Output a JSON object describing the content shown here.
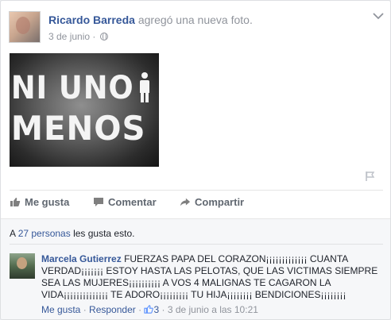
{
  "post": {
    "author": "Ricardo Barreda",
    "action": "agregó una nueva foto.",
    "date": "3 de junio",
    "dot": "·",
    "photo_text": {
      "line1": "NI UNO",
      "line2": "MENOS"
    }
  },
  "actions": {
    "like": "Me gusta",
    "comment": "Comentar",
    "share": "Compartir"
  },
  "likes_summary": {
    "prefix": "A ",
    "people": "27 personas",
    "suffix": " les gusta esto."
  },
  "comment": {
    "author": "Marcela Gutierrez",
    "text": "FUERZAS PAPA DEL CORAZON¡¡¡¡¡¡¡¡¡¡¡¡¡ CUANTA VERDAD¡¡¡¡¡¡¡ ESTOY HASTA LAS PELOTAS, QUE LAS VICTIMAS SIEMPRE SEA LAS MUJERES¡¡¡¡¡¡¡¡¡¡ A VOS 4 MALIGNAS TE CAGARON LA VIDA¡¡¡¡¡¡¡¡¡¡¡¡¡¡ TE ADORO¡¡¡¡¡¡¡¡¡ TU HIJA¡¡¡¡¡¡¡¡ BENDICIONES¡¡¡¡¡¡¡¡",
    "like_label": "Me gusta",
    "reply_label": "Responder",
    "likes_count": "3",
    "timestamp": "3 de junio a las 10:21",
    "sep": "·"
  },
  "icons": {
    "chevron": "chevron-down-icon",
    "privacy": "globe-icon",
    "flag": "flag-icon",
    "like": "thumbs-up-icon",
    "comment": "speech-bubble-icon",
    "share": "share-arrow-icon"
  },
  "colors": {
    "link": "#365899",
    "muted": "#90949c",
    "like_blue": "#5890ff"
  }
}
